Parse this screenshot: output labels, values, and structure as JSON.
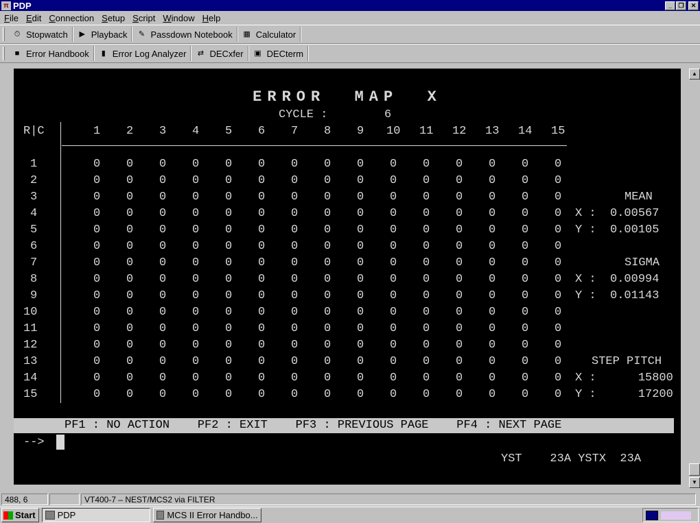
{
  "window": {
    "title": "PDP",
    "app_icon": "PDP-icon",
    "minimize_label": "_",
    "restore_label": "❐",
    "close_label": "✕"
  },
  "menu": [
    "File",
    "Edit",
    "Connection",
    "Setup",
    "Script",
    "Window",
    "Help"
  ],
  "menu_underline": [
    "F",
    "E",
    "C",
    "S",
    "S",
    "W",
    "H"
  ],
  "toolbar1": [
    {
      "label": "Stopwatch",
      "icon": "stopwatch-icon",
      "glyph": "⏱"
    },
    {
      "label": "Playback",
      "icon": "play-icon",
      "glyph": "▶"
    },
    {
      "label": "Passdown Notebook",
      "icon": "notebook-pen-icon",
      "glyph": "✎"
    },
    {
      "label": "Calculator",
      "icon": "calculator-icon",
      "glyph": "▦"
    }
  ],
  "toolbar2": [
    {
      "label": "Error Handbook",
      "icon": "book-icon",
      "glyph": "■"
    },
    {
      "label": "Error Log Analyzer",
      "icon": "bar-chart-icon",
      "glyph": "▮"
    },
    {
      "label": "DECxfer",
      "icon": "transfer-icon",
      "glyph": "⇄"
    },
    {
      "label": "DECterm",
      "icon": "terminal-icon",
      "glyph": "▣"
    }
  ],
  "terminal": {
    "title": "ERROR  MAP  X",
    "cycle_label": "CYCLE :",
    "cycle_value": "6",
    "corner_label": "R|C",
    "columns": [
      "1",
      "2",
      "3",
      "4",
      "5",
      "6",
      "7",
      "8",
      "9",
      "10",
      "11",
      "12",
      "13",
      "14",
      "15"
    ],
    "rows": [
      {
        "r": "1",
        "values": [
          "0",
          "0",
          "0",
          "0",
          "0",
          "0",
          "0",
          "0",
          "0",
          "0",
          "0",
          "0",
          "0",
          "0",
          "0"
        ]
      },
      {
        "r": "2",
        "values": [
          "0",
          "0",
          "0",
          "0",
          "0",
          "0",
          "0",
          "0",
          "0",
          "0",
          "0",
          "0",
          "0",
          "0",
          "0"
        ]
      },
      {
        "r": "3",
        "values": [
          "0",
          "0",
          "0",
          "0",
          "0",
          "0",
          "0",
          "0",
          "0",
          "0",
          "0",
          "0",
          "0",
          "0",
          "0"
        ]
      },
      {
        "r": "4",
        "values": [
          "0",
          "0",
          "0",
          "0",
          "0",
          "0",
          "0",
          "0",
          "0",
          "0",
          "0",
          "0",
          "0",
          "0",
          "0"
        ]
      },
      {
        "r": "5",
        "values": [
          "0",
          "0",
          "0",
          "0",
          "0",
          "0",
          "0",
          "0",
          "0",
          "0",
          "0",
          "0",
          "0",
          "0",
          "0"
        ]
      },
      {
        "r": "6",
        "values": [
          "0",
          "0",
          "0",
          "0",
          "0",
          "0",
          "0",
          "0",
          "0",
          "0",
          "0",
          "0",
          "0",
          "0",
          "0"
        ]
      },
      {
        "r": "7",
        "values": [
          "0",
          "0",
          "0",
          "0",
          "0",
          "0",
          "0",
          "0",
          "0",
          "0",
          "0",
          "0",
          "0",
          "0",
          "0"
        ]
      },
      {
        "r": "8",
        "values": [
          "0",
          "0",
          "0",
          "0",
          "0",
          "0",
          "0",
          "0",
          "0",
          "0",
          "0",
          "0",
          "0",
          "0",
          "0"
        ]
      },
      {
        "r": "9",
        "values": [
          "0",
          "0",
          "0",
          "0",
          "0",
          "0",
          "0",
          "0",
          "0",
          "0",
          "0",
          "0",
          "0",
          "0",
          "0"
        ]
      },
      {
        "r": "10",
        "values": [
          "0",
          "0",
          "0",
          "0",
          "0",
          "0",
          "0",
          "0",
          "0",
          "0",
          "0",
          "0",
          "0",
          "0",
          "0"
        ]
      },
      {
        "r": "11",
        "values": [
          "0",
          "0",
          "0",
          "0",
          "0",
          "0",
          "0",
          "0",
          "0",
          "0",
          "0",
          "0",
          "0",
          "0",
          "0"
        ]
      },
      {
        "r": "12",
        "values": [
          "0",
          "0",
          "0",
          "0",
          "0",
          "0",
          "0",
          "0",
          "0",
          "0",
          "0",
          "0",
          "0",
          "0",
          "0"
        ]
      },
      {
        "r": "13",
        "values": [
          "0",
          "0",
          "0",
          "0",
          "0",
          "0",
          "0",
          "0",
          "0",
          "0",
          "0",
          "0",
          "0",
          "0",
          "0"
        ]
      },
      {
        "r": "14",
        "values": [
          "0",
          "0",
          "0",
          "0",
          "0",
          "0",
          "0",
          "0",
          "0",
          "0",
          "0",
          "0",
          "0",
          "0",
          "0"
        ]
      },
      {
        "r": "15",
        "values": [
          "0",
          "0",
          "0",
          "0",
          "0",
          "0",
          "0",
          "0",
          "0",
          "0",
          "0",
          "0",
          "0",
          "0",
          "0"
        ]
      }
    ],
    "stats": {
      "mean_label": "MEAN",
      "mean_x": "X :  0.00567",
      "mean_y": "Y :  0.00105",
      "sigma_label": "SIGMA",
      "sigma_x": "X :  0.00994",
      "sigma_y": "Y :  0.01143",
      "step_label": "STEP PITCH",
      "step_x": "X :      15800",
      "step_y": "Y :      17200"
    },
    "fkeys": "PF1 : NO ACTION    PF2 : EXIT    PF3 : PREVIOUS PAGE    PF4 : NEXT PAGE",
    "prompt": "-->",
    "footer": "YST    23A YSTX  23A"
  },
  "statusbar": {
    "position": "488, 6",
    "blank": "",
    "connection": "VT400-7 – NEST/MCS2 via FILTER"
  },
  "taskbar": {
    "start": "Start",
    "tasks": [
      {
        "label": "PDP",
        "icon": "PDP-icon",
        "active": true
      },
      {
        "label": "MCS II Error Handbo...",
        "icon": "book-window-icon",
        "active": false
      }
    ]
  },
  "colors": {
    "titlebar": "#000080",
    "terminal_bg": "#000000",
    "terminal_fg": "#d8d8d8",
    "chrome": "#c0c0c0"
  }
}
